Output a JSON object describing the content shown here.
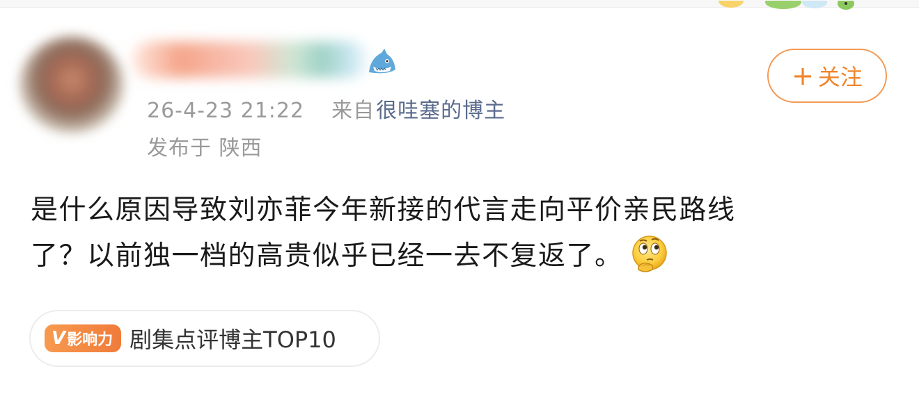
{
  "post": {
    "timestamp": "26-4-23 21:22",
    "source_prefix": "来自",
    "source_name": "很哇塞的博主",
    "location": "发布于 陕西",
    "text_line1": "是什么原因导致刘亦菲今年新接的代言走向平价亲民路线",
    "text_line2": "了？以前独一档的高贵似乎已经一去不复返了。"
  },
  "follow_button": {
    "plus": "+",
    "label": "关注"
  },
  "influence_tag": {
    "badge_v": "V",
    "badge_label": "影响力",
    "text": "剧集点评博主TOP10"
  },
  "icons": {
    "avatar": "avatar",
    "badge": "shark-badge-icon",
    "emoji": "thinking-face-emoji"
  },
  "colors": {
    "accent_orange": "#f0852b",
    "source_link": "#5a6b8c",
    "meta_gray": "#9a9a9a",
    "text": "#1a1a1a"
  }
}
